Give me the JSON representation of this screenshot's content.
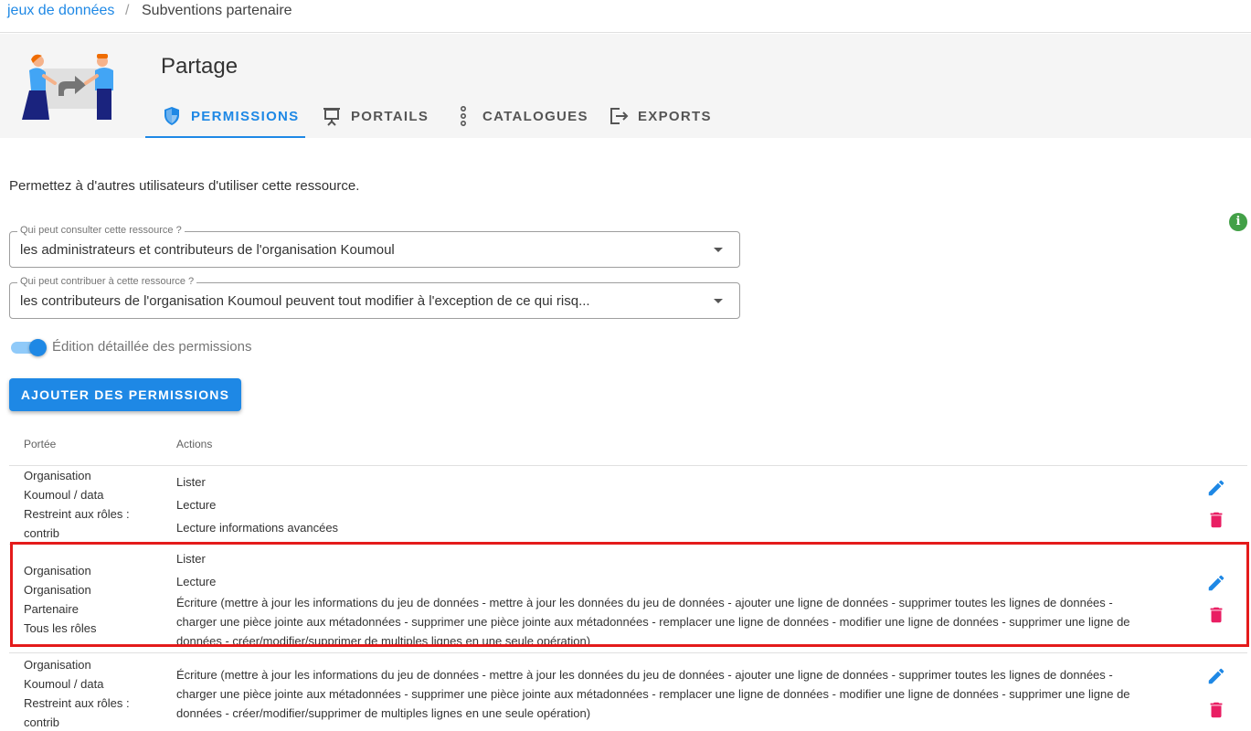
{
  "breadcrumb": {
    "link": "jeux de données",
    "separator": "/",
    "current": "Subventions partenaire"
  },
  "header": {
    "title": "Partage",
    "tabs": [
      {
        "label": "PERMISSIONS",
        "icon": "shield-icon",
        "active": true
      },
      {
        "label": "PORTAILS",
        "icon": "presentation-icon",
        "active": false
      },
      {
        "label": "CATALOGUES",
        "icon": "dots-vertical-icon",
        "active": false
      },
      {
        "label": "EXPORTS",
        "icon": "export-icon",
        "active": false
      }
    ]
  },
  "description": "Permettez à d'autres utilisateurs d'utiliser cette ressource.",
  "selects": {
    "read": {
      "label": "Qui peut consulter cette ressource ?",
      "value": "les administrateurs et contributeurs de l'organisation Koumoul"
    },
    "write": {
      "label": "Qui peut contribuer à cette ressource ?",
      "value": "les contributeurs de l'organisation Koumoul peuvent tout modifier à l'exception de ce qui risq..."
    }
  },
  "toggle": {
    "label": "Édition détaillée des permissions",
    "on": true
  },
  "add_button": "AJOUTER DES PERMISSIONS",
  "table": {
    "headers": {
      "scope": "Portée",
      "actions": "Actions"
    },
    "rows": [
      {
        "scope": [
          "Organisation",
          "Koumoul / data",
          "Restreint aux rôles :",
          "contrib"
        ],
        "actions": [
          "Lister",
          "Lecture",
          "Lecture informations avancées"
        ]
      },
      {
        "scope": [
          "Organisation",
          "Organisation",
          "Partenaire",
          "Tous les rôles"
        ],
        "actions": [
          "Lister",
          "Lecture"
        ],
        "long_action": "Écriture (mettre à jour les informations du jeu de données - mettre à jour les données du jeu de données - ajouter une ligne de données - supprimer toutes les lignes de données - charger une pièce jointe aux métadonnées - supprimer une pièce jointe aux métadonnées - remplacer une ligne de données - modifier une ligne de données - supprimer une ligne de données - créer/modifier/supprimer de multiples lignes en une seule opération)"
      },
      {
        "scope": [
          "Organisation",
          "Koumoul / data",
          "Restreint aux rôles :",
          "contrib"
        ],
        "long_action": "Écriture (mettre à jour les informations du jeu de données - mettre à jour les données du jeu de données - ajouter une ligne de données - supprimer toutes les lignes de données - charger une pièce jointe aux métadonnées - supprimer une pièce jointe aux métadonnées - remplacer une ligne de données - modifier une ligne de données - supprimer une ligne de données - créer/modifier/supprimer de multiples lignes en une seule opération)"
      }
    ]
  },
  "colors": {
    "accent": "#1e88e5",
    "delete": "#e91e63",
    "info": "#43a047",
    "highlight": "#e41b1b"
  }
}
